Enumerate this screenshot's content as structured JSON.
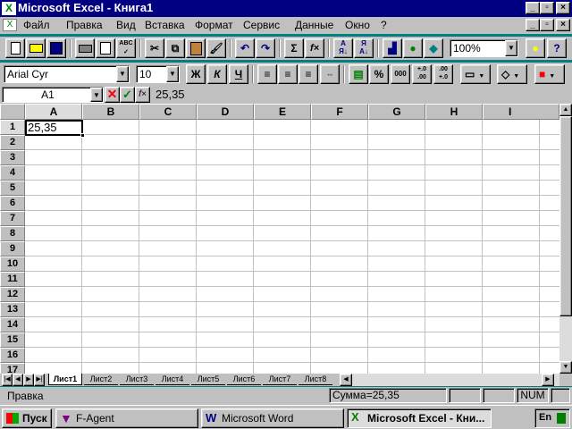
{
  "window": {
    "title": "Microsoft Excel - Книга1",
    "minimize": "_",
    "restore": "▫",
    "close": "×"
  },
  "menu": [
    "Файл",
    "Правка",
    "Вид",
    "Вставка",
    "Формат",
    "Сервис",
    "Данные",
    "Окно",
    "?"
  ],
  "toolbar": {
    "zoom": "100%",
    "font": "Arial Cyr",
    "size": "10",
    "bold": "Ж",
    "italic": "К",
    "underline": "Ч",
    "percent": "%",
    "thousands": "000",
    "sum": "Σ",
    "fx": "f×"
  },
  "formula_bar": {
    "cell_ref": "A1",
    "content": "25,35",
    "fx": "f×"
  },
  "sheet": {
    "columns": [
      "A",
      "B",
      "C",
      "D",
      "E",
      "F",
      "G",
      "H",
      "I"
    ],
    "rows": [
      "1",
      "2",
      "3",
      "4",
      "5",
      "6",
      "7",
      "8",
      "9",
      "10",
      "11",
      "12",
      "13",
      "14",
      "15",
      "16",
      "17"
    ],
    "a1": "25,35"
  },
  "tabs": [
    "Лист1",
    "Лист2",
    "Лист3",
    "Лист4",
    "Лист5",
    "Лист6",
    "Лист7",
    "Лист8"
  ],
  "status": {
    "mode": "Правка",
    "sum": "Сумма=25,35",
    "num": "NUM"
  },
  "taskbar": {
    "start": "Пуск",
    "items": [
      "F-Agent",
      "Microsoft Word",
      "Microsoft Excel - Кни..."
    ],
    "lang": "En"
  }
}
